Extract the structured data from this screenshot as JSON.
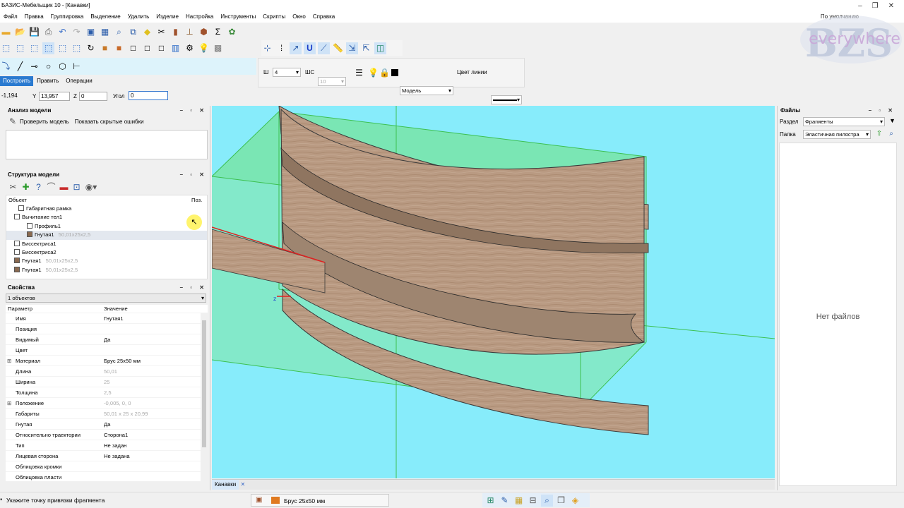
{
  "window": {
    "title": "БАЗИС-Мебельщик 10 - [Канавки]"
  },
  "menu": [
    "Файл",
    "Правка",
    "Группировка",
    "Выделение",
    "Удалить",
    "Изделие",
    "Настройка",
    "Инструменты",
    "Скрипты",
    "Окно",
    "Справка"
  ],
  "profile_label": "По умолчанию",
  "watermark": {
    "logo": "BZS",
    "text": "everywhere"
  },
  "toolbar3": {
    "sh_label": "Ш",
    "sh_value": "4",
    "shs_label": "ШС",
    "shs_value": "10",
    "layer_value": "Модель",
    "line_color_label": "Цвет линии"
  },
  "tabs": [
    "Построить",
    "Править",
    "Операции"
  ],
  "coords": {
    "x": "-1,194",
    "y_label": "Y",
    "y": "13,957",
    "z_label": "Z",
    "z": "0",
    "angle_label": "Угол",
    "angle": "0"
  },
  "analysis": {
    "title": "Анализ модели",
    "check": "Проверить модель",
    "show_hidden": "Показать скрытые ошибки"
  },
  "structure": {
    "title": "Структура модели",
    "col_object": "Объект",
    "col_pos": "Поз.",
    "items": [
      {
        "name": "Габаритная рамка",
        "dim": ""
      },
      {
        "name": "Вычитание тел1",
        "dim": ""
      },
      {
        "name": "Профиль1",
        "dim": ""
      },
      {
        "name": "Гнутая1",
        "dim": "50,01x25x2,5"
      },
      {
        "name": "Биссектриса1",
        "dim": ""
      },
      {
        "name": "Биссектриса2",
        "dim": ""
      },
      {
        "name": "Гнутая1",
        "dim": "50,01x25x2,5"
      },
      {
        "name": "Гнутая1",
        "dim": "50,01x25x2,5"
      }
    ]
  },
  "properties": {
    "title": "Свойства",
    "selector": "1 объектов",
    "col_param": "Параметр",
    "col_value": "Значение",
    "rows": [
      {
        "p": "Имя",
        "v": "Гнутая1"
      },
      {
        "p": "Позиция",
        "v": ""
      },
      {
        "p": "Видимый",
        "v": "Да"
      },
      {
        "p": "Цвет",
        "v": ""
      },
      {
        "p": "Материал",
        "v": "Брус 25x50 мм"
      },
      {
        "p": "Длина",
        "v": "50,01"
      },
      {
        "p": "Ширина",
        "v": "25"
      },
      {
        "p": "Толщина",
        "v": "2,5"
      },
      {
        "p": "Положение",
        "v": "-0,005, 0, 0"
      },
      {
        "p": "Габариты",
        "v": "50,01 x 25 x 20,99"
      },
      {
        "p": "Гнутая",
        "v": "Да"
      },
      {
        "p": "Относительно траектории",
        "v": "Сторона1"
      },
      {
        "p": "Тип",
        "v": "Не задан"
      },
      {
        "p": "Лицевая сторона",
        "v": "Не задана"
      },
      {
        "p": "Облицовка кромки",
        "v": ""
      },
      {
        "p": "Облицовка пласти",
        "v": ""
      }
    ]
  },
  "viewport": {
    "tab": "Канавки"
  },
  "files": {
    "title": "Файлы",
    "section_label": "Раздел",
    "section_value": "Фрагменты",
    "folder_label": "Папка",
    "folder_value": "Эластичная пилястра",
    "empty": "Нет файлов"
  },
  "status": {
    "hint": "Укажите точку привязки фрагмента",
    "material": "Брус 25x50 мм"
  }
}
